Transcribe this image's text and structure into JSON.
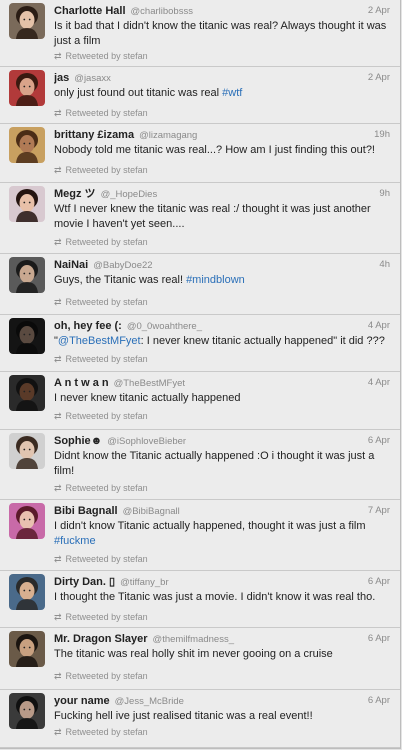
{
  "colors": {
    "background": "#ececec",
    "name": "#222222",
    "meta": "#8a8a8a",
    "link": "#2a6fb8"
  },
  "retweet_icon": "retweet-icon",
  "tweets": [
    {
      "name": "Charlotte Hall",
      "handle": "@charlibobsss",
      "time": "2 Apr",
      "text_before": "Is it bad that I didn't know the titanic was real? Always thought it was just a film",
      "link": "",
      "text_after": "",
      "retweeted_by": "Retweeted by stefan",
      "avatar": {
        "bg": "#7a6a5a",
        "skin": "#e4c2a8",
        "hair": "#2a1c14"
      }
    },
    {
      "name": "jas",
      "handle": "@jasaxx",
      "time": "2 Apr",
      "text_before": "only just found out titanic was real ",
      "link": "#wtf",
      "text_after": "",
      "retweeted_by": "Retweeted by stefan",
      "avatar": {
        "bg": "#b23a3a",
        "skin": "#d9a38a",
        "hair": "#3a1a10"
      }
    },
    {
      "name": "brittany £izama",
      "handle": "@lizamagang",
      "time": "19h",
      "text_before": "Nobody told me titanic was real...? How am I just finding this out?!",
      "link": "",
      "text_after": "",
      "retweeted_by": "Retweeted by stefan",
      "avatar": {
        "bg": "#c8a060",
        "skin": "#b07a55",
        "hair": "#4a2c16"
      }
    },
    {
      "name": "Megz ツ",
      "handle": "@_HopeDies",
      "time": "9h",
      "text_before": "Wtf I never knew the titanic was real :/ thought it was just another movie I haven't yet seen....",
      "link": "",
      "text_after": "",
      "retweeted_by": "Retweeted by stefan",
      "avatar": {
        "bg": "#d8c9d0",
        "skin": "#e8c0a8",
        "hair": "#241410"
      }
    },
    {
      "name": "NaiNai",
      "handle": "@BabyDoe22",
      "time": "4h",
      "text_before": "Guys, the Titanic was real! ",
      "link": "#mindblown",
      "text_after": "",
      "retweeted_by": "Retweeted by stefan",
      "avatar": {
        "bg": "#5a5a5a",
        "skin": "#c8a890",
        "hair": "#1a1a1a"
      }
    },
    {
      "name": "oh, hey fee (:",
      "handle": "@0_0woahthere_",
      "time": "4 Apr",
      "text_before": "\"",
      "link": "@TheBestMFyet",
      "text_after": ": I never knew titanic actually happened\" it did ???",
      "retweeted_by": "Retweeted by stefan",
      "avatar": {
        "bg": "#141414",
        "skin": "#5a4a40",
        "hair": "#0a0a0a"
      }
    },
    {
      "name": "A n t w a n",
      "handle": "@TheBestMFyet",
      "time": "4 Apr",
      "text_before": "I never knew titanic actually happened",
      "link": "",
      "text_after": "",
      "retweeted_by": "Retweeted by stefan",
      "avatar": {
        "bg": "#2a2a2a",
        "skin": "#5a3a28",
        "hair": "#111111"
      }
    },
    {
      "name": "Sophie☻",
      "handle": "@iSophloveBieber",
      "time": "6 Apr",
      "text_before": "Didnt know the Titanic actually happened :O i thought it was just a film!",
      "link": "",
      "text_after": "",
      "retweeted_by": "Retweeted by stefan",
      "avatar": {
        "bg": "#d0d0d0",
        "skin": "#e0c4b0",
        "hair": "#3a2a20"
      }
    },
    {
      "name": "Bibi Bagnall",
      "handle": "@BibiBagnall",
      "time": "7 Apr",
      "text_before": "I didn't know Titanic actually happened, thought it was just a film ",
      "link": "#fuckme",
      "text_after": "",
      "retweeted_by": "Retweeted by stefan",
      "avatar": {
        "bg": "#c86aa8",
        "skin": "#e8c0b0",
        "hair": "#5a1a2a"
      }
    },
    {
      "name": "Dirty Dan. ▯",
      "handle": "@tiffany_br",
      "time": "6 Apr",
      "text_before": "I thought the Titanic was just a movie. I didn't know it was real tho.",
      "link": "",
      "text_after": "",
      "retweeted_by": "Retweeted by stefan",
      "avatar": {
        "bg": "#4a6a8a",
        "skin": "#d8b090",
        "hair": "#2a2a2a"
      }
    },
    {
      "name": "Mr. Dragon Slayer",
      "handle": "@themilfmadness_",
      "time": "6 Apr",
      "text_before": "The titanic was real holly shit im never gooing on a cruise",
      "link": "",
      "text_after": "",
      "retweeted_by": "Retweeted by stefan",
      "avatar": {
        "bg": "#6a5a48",
        "skin": "#c8a080",
        "hair": "#1a1410"
      }
    },
    {
      "name": "your name",
      "handle": "@Jess_McBride",
      "time": "6 Apr",
      "text_before": "Fucking hell ive just realised titanic was a real event!!",
      "link": "",
      "text_after": "",
      "retweeted_by": "Retweeted by stefan",
      "avatar": {
        "bg": "#3a3a3a",
        "skin": "#b89a88",
        "hair": "#101010"
      }
    }
  ]
}
